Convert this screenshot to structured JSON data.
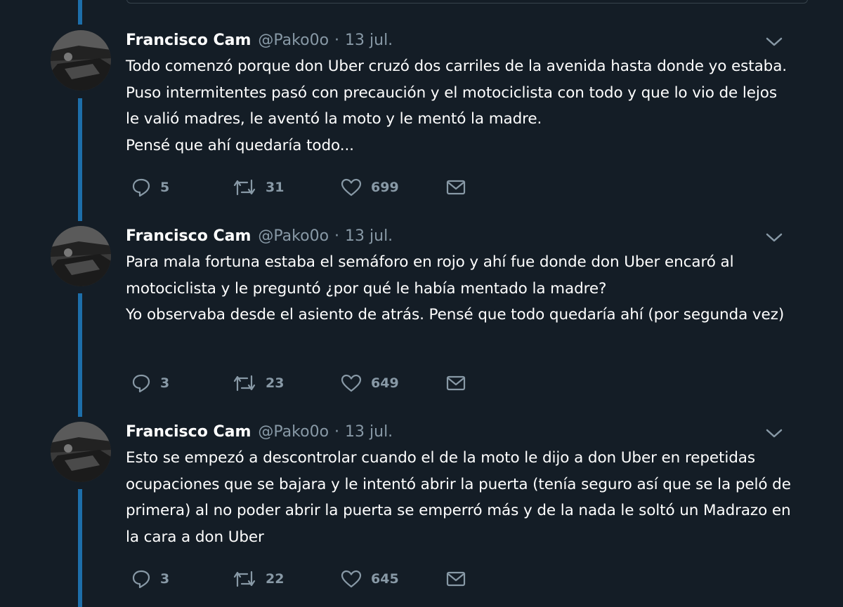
{
  "tweets": [
    {
      "name": "Francisco Cam",
      "handle": "@Pako0o",
      "separator": "·",
      "date": "13 jul.",
      "text": "Todo comenzó porque don Uber cruzó dos carriles de la avenida hasta donde yo estaba. Puso intermitentes pasó con precaución y el motociclista con todo y que lo vio de lejos le valió madres, le aventó la moto y le mentó la madre.\nPensé que ahí quedaría todo...",
      "replies": "5",
      "retweets": "31",
      "likes": "699"
    },
    {
      "name": "Francisco Cam",
      "handle": "@Pako0o",
      "separator": "·",
      "date": "13 jul.",
      "text": "Para mala fortuna estaba el semáforo en rojo y ahí fue donde don Uber encaró al motociclista y le preguntó ¿por qué le había mentado la madre?\nYo observaba desde el asiento de atrás. Pensé que todo quedaría ahí (por segunda vez)",
      "replies": "3",
      "retweets": "23",
      "likes": "649"
    },
    {
      "name": "Francisco Cam",
      "handle": "@Pako0o",
      "separator": "·",
      "date": "13 jul.",
      "text": "Esto se empezó a descontrolar cuando el de la moto le dijo a don Uber en repetidas ocupaciones que se bajara y le intentó abrir la puerta (tenía seguro así que se la peló de primera) al no poder abrir la puerta se emperró más y de la nada le soltó un Madrazo en la cara a don Uber",
      "replies": "3",
      "retweets": "22",
      "likes": "645"
    }
  ],
  "icons": {
    "reply": "reply-icon",
    "retweet": "retweet-icon",
    "like": "heart-icon",
    "message": "direct-message-icon",
    "more": "chevron-down-icon"
  },
  "colors": {
    "background": "#141d26",
    "thread_line": "#1d6ea9",
    "secondary_text": "#8899a6"
  }
}
